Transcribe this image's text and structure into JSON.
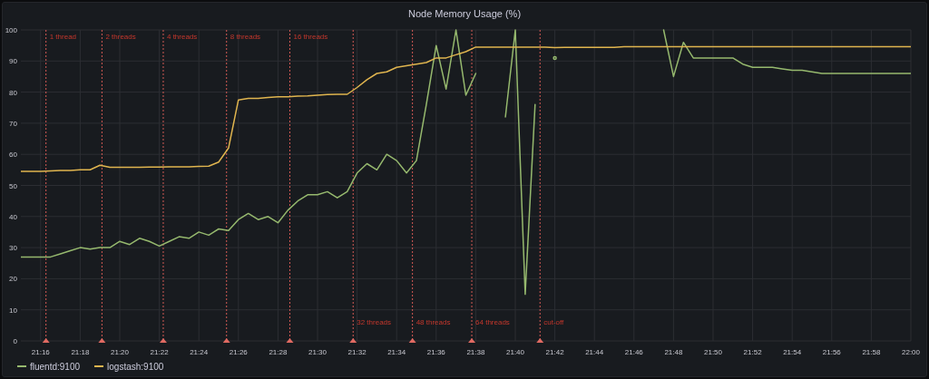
{
  "panel": {
    "title": "Node Memory Usage (%)",
    "chart_data": {
      "type": "line",
      "grid": true,
      "ylim": [
        0,
        100
      ],
      "yticks": [
        0,
        10,
        20,
        30,
        40,
        50,
        60,
        70,
        80,
        90,
        100
      ],
      "categories": [
        null,
        null,
        "21:16",
        null,
        null,
        null,
        "21:18",
        null,
        null,
        null,
        "21:20",
        null,
        null,
        null,
        "21:22",
        null,
        null,
        null,
        "21:24",
        null,
        null,
        null,
        "21:26",
        null,
        null,
        null,
        "21:28",
        null,
        null,
        null,
        "21:30",
        null,
        null,
        null,
        "21:32",
        null,
        null,
        null,
        "21:34",
        null,
        null,
        null,
        "21:36",
        null,
        null,
        null,
        "21:38",
        null,
        null,
        null,
        "21:40",
        null,
        null,
        null,
        "21:42",
        null,
        null,
        null,
        "21:44",
        null,
        null,
        null,
        "21:46",
        null,
        null,
        null,
        "21:48",
        null,
        null,
        null,
        "21:50",
        null,
        null,
        null,
        "21:52",
        null,
        null,
        null,
        "21:54",
        null,
        null,
        null,
        "21:56",
        null,
        null,
        null,
        "21:58",
        null,
        null,
        null,
        "22:00"
      ],
      "series": [
        {
          "name": "fluentd:9100",
          "color": "#96b96e",
          "values": [
            27,
            27,
            27,
            27,
            28,
            29,
            30,
            29.5,
            30,
            30,
            32,
            31,
            33,
            32,
            30.5,
            32,
            33.5,
            33,
            35,
            34,
            36,
            35.5,
            39,
            41,
            39,
            40,
            38,
            42,
            45,
            47,
            47,
            48,
            46,
            48,
            54,
            57,
            55,
            60,
            58,
            54,
            58,
            76,
            95,
            81,
            100,
            79,
            86,
            null,
            null,
            72,
            100,
            15,
            76,
            null,
            91,
            null,
            null,
            null,
            null,
            null,
            null,
            null,
            null,
            null,
            null,
            100,
            85,
            96,
            91,
            91,
            91,
            91,
            91,
            89,
            88,
            88,
            88,
            87.5,
            87,
            87,
            86.5,
            86,
            86,
            86,
            86,
            86,
            86,
            86,
            86,
            86,
            86
          ]
        },
        {
          "name": "logstash:9100",
          "color": "#e0b54f",
          "values": [
            54.5,
            54.5,
            54.5,
            54.7,
            54.8,
            54.8,
            55,
            55,
            56.5,
            55.8,
            55.8,
            55.8,
            55.8,
            55.9,
            55.9,
            56,
            56,
            56,
            56.1,
            56.2,
            57.5,
            62,
            77.5,
            78,
            78,
            78.3,
            78.5,
            78.5,
            78.7,
            78.8,
            79,
            79.2,
            79.3,
            79.3,
            81.5,
            84,
            86,
            86.5,
            88,
            88.5,
            89,
            89.5,
            91,
            91,
            92,
            93,
            94.5,
            94.5,
            94.5,
            94.5,
            94.5,
            94.5,
            94.5,
            94.5,
            94.3,
            94.4,
            94.4,
            94.4,
            94.4,
            94.4,
            94.4,
            94.6,
            94.6,
            94.6,
            94.6,
            94.6,
            94.6,
            94.6,
            94.6,
            94.6,
            94.6,
            94.6,
            94.6,
            94.6,
            94.6,
            94.6,
            94.6,
            94.6,
            94.6,
            94.6,
            94.6,
            94.6,
            94.6,
            94.6,
            94.6,
            94.6,
            94.6,
            94.6,
            94.6,
            94.6,
            94.6
          ]
        }
      ],
      "annotations": [
        "1 thread",
        "2 threads",
        "4 threads",
        "8 threads",
        "16 threads",
        "32 threads",
        "48 threads",
        "64 threads",
        "cut-off"
      ]
    }
  }
}
